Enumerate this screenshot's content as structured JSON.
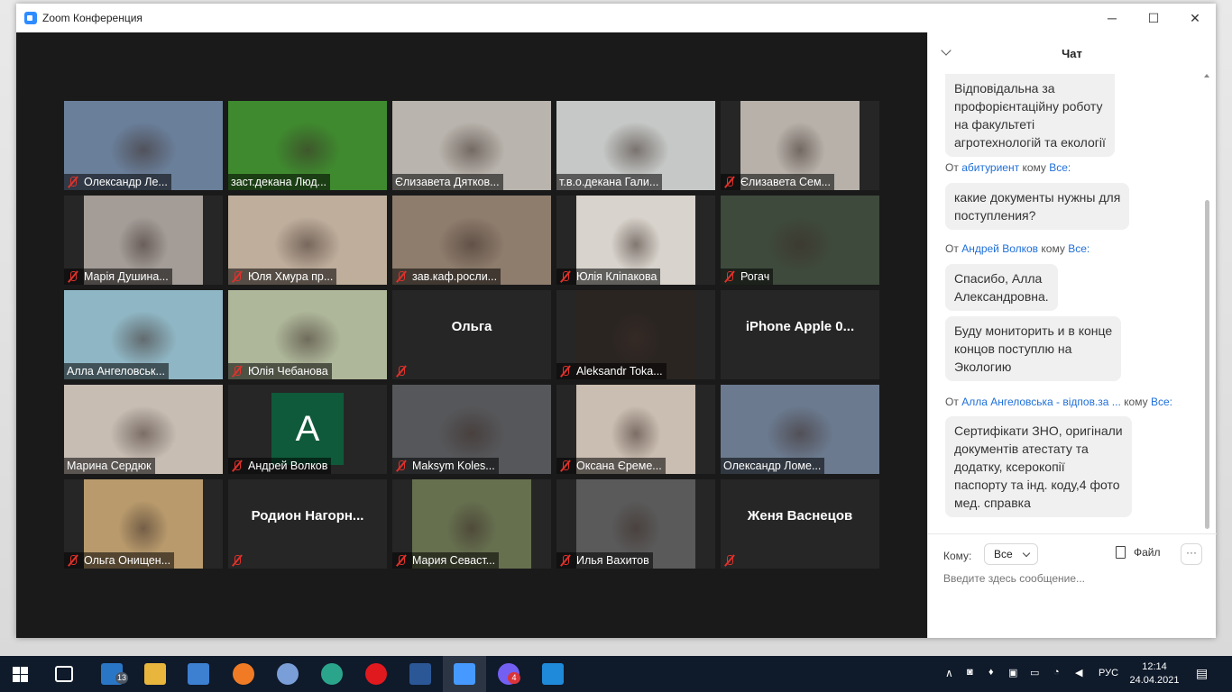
{
  "window": {
    "title": "Zoom Конференция",
    "controls": {
      "minimize": "─",
      "maximize": "☐",
      "close": "✕"
    }
  },
  "participants": [
    {
      "name": "Олександр Ле...",
      "muted": true,
      "video": "#6a7f9a",
      "row": 0,
      "col": 0
    },
    {
      "name": "заст.декана Люд...",
      "muted": false,
      "video": "#3f8a2f",
      "row": 0,
      "col": 1
    },
    {
      "name": "Єлизавета Дятков...",
      "muted": false,
      "video": "#b9b4ad",
      "row": 0,
      "col": 2
    },
    {
      "name": "т.в.о.декана Гали...",
      "muted": false,
      "video": "#c5c8c6",
      "row": 0,
      "col": 3
    },
    {
      "name": "Єлизавета Сем...",
      "muted": true,
      "video": "#b7b1aa",
      "row": 0,
      "col": 4,
      "narrow": true
    },
    {
      "name": "Марія Душина...",
      "muted": true,
      "video": "#a39c97",
      "row": 1,
      "col": 0,
      "narrow": true
    },
    {
      "name": "Юля Хмура пр...",
      "muted": true,
      "video": "#bfae9c",
      "row": 1,
      "col": 1
    },
    {
      "name": "зав.каф.росли...",
      "muted": true,
      "video": "#8e7d6d",
      "row": 1,
      "col": 2
    },
    {
      "name": "Юлія Кліпакова",
      "muted": true,
      "video": "#d8d3cc",
      "row": 1,
      "col": 3,
      "narrow": true
    },
    {
      "name": "Рогач",
      "muted": true,
      "video": "#3e4a3c",
      "row": 1,
      "col": 4
    },
    {
      "name": "Алла Ангеловськ...",
      "muted": false,
      "video": "#8fb6c4",
      "row": 2,
      "col": 0
    },
    {
      "name": "Юлія Чебанова",
      "muted": true,
      "video": "#aeb79a",
      "row": 2,
      "col": 1
    },
    {
      "name": "",
      "center": "Ольга",
      "muted": true,
      "row": 2,
      "col": 2
    },
    {
      "name": "Aleksandr Toka...",
      "muted": true,
      "video": "#2b2522",
      "row": 2,
      "col": 3,
      "narrow": true
    },
    {
      "name": "",
      "center": "iPhone Apple 0...",
      "muted": false,
      "row": 2,
      "col": 4
    },
    {
      "name": "Марина Сердюк",
      "muted": false,
      "video": "#c7bdb3",
      "row": 3,
      "col": 0,
      "active": true
    },
    {
      "name": "Андрей Волков",
      "muted": true,
      "avatar": "A",
      "row": 3,
      "col": 1
    },
    {
      "name": "Maksym Koles...",
      "muted": true,
      "video": "#56575a",
      "row": 3,
      "col": 2
    },
    {
      "name": "Оксана Єреме...",
      "muted": true,
      "video": "#cabdb1",
      "row": 3,
      "col": 3,
      "narrow": true
    },
    {
      "name": "Олександр Ломе...",
      "muted": false,
      "video": "#6b7a8f",
      "row": 3,
      "col": 4
    },
    {
      "name": "Ольга Онищен...",
      "muted": true,
      "video": "#b89a6c",
      "row": 4,
      "col": 0,
      "narrow": true
    },
    {
      "name": "",
      "center": "Родион  Нагорн...",
      "muted": true,
      "row": 4,
      "col": 1
    },
    {
      "name": "Мария Севаст...",
      "muted": true,
      "video": "#66704f",
      "row": 4,
      "col": 2,
      "narrow": true
    },
    {
      "name": "Илья Вахитов",
      "muted": true,
      "video": "#5a5a5a",
      "row": 4,
      "col": 3,
      "narrow": true
    },
    {
      "name": "",
      "center": "Женя Васнецов",
      "muted": true,
      "row": 4,
      "col": 4
    }
  ],
  "chat": {
    "title": "Чат",
    "messages": [
      {
        "bubble": " Відповідальна за\nпрофорієнтаційну роботу\nна факультеті\nагротехнологій та екології"
      },
      {
        "from_prefix": "От",
        "from": "абитуриент",
        "to_prefix": "кому",
        "to": "Все:"
      },
      {
        "bubble": "какие документы нужны для\nпоступления?"
      },
      {
        "from_prefix": "От",
        "from": "Андрей Волков",
        "to_prefix": "кому",
        "to": "Все:"
      },
      {
        "bubble": "Спасибо, Алла\nАлександровна."
      },
      {
        "bubble": "Буду мониторить и в конце\nконцов поступлю на\nЭкологию"
      },
      {
        "from_prefix": "От",
        "from": "Алла Ангеловська - відпов.за ...",
        "to_prefix": "кому",
        "to": "Все:"
      },
      {
        "bubble": "Сертифікати ЗНО, оригінали\nдокументів атестату та\nдодатку, ксерокопії\nпаспорту та інд. коду,4 фото\nмед. справка"
      }
    ],
    "to_label": "Кому:",
    "to_value": "Все",
    "file_label": "Файл",
    "more_label": "···",
    "input_placeholder": "Введите здесь сообщение..."
  },
  "taskbar": {
    "mail_badge": "13",
    "viber_badge": "4",
    "language": "РУС",
    "time": "12:14",
    "date": "24.04.2021"
  }
}
